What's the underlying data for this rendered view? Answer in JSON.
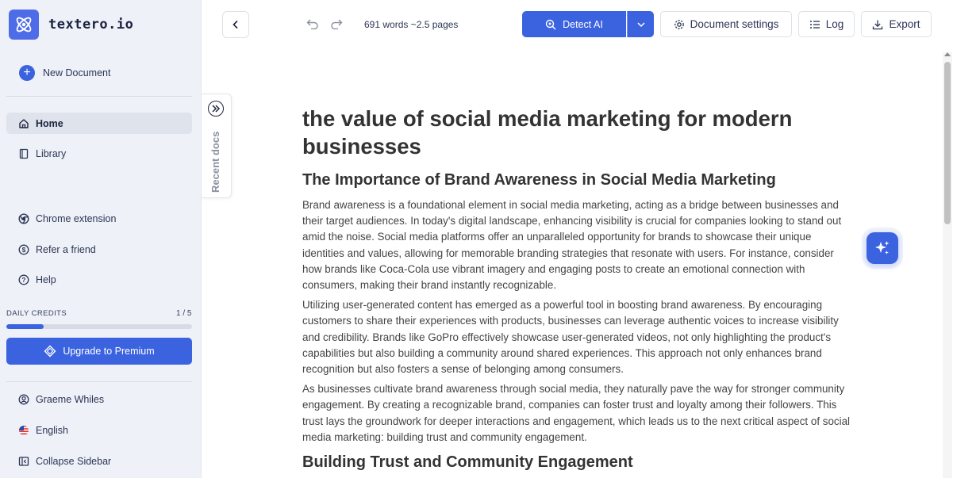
{
  "app": {
    "name": "textero.io"
  },
  "sidebar": {
    "new_document": "New Document",
    "nav": [
      {
        "label": "Home",
        "icon": "home-icon",
        "active": true
      },
      {
        "label": "Library",
        "icon": "book-icon",
        "active": false
      }
    ],
    "secondary": [
      {
        "label": "Chrome extension",
        "icon": "chrome-icon"
      },
      {
        "label": "Refer a friend",
        "icon": "dollar-icon"
      },
      {
        "label": "Help",
        "icon": "help-icon"
      }
    ],
    "credits": {
      "label": "DAILY CREDITS",
      "count": "1 / 5",
      "fraction": 0.2
    },
    "upgrade": "Upgrade to Premium",
    "footer": [
      {
        "label": "Graeme Whiles",
        "icon": "user-icon"
      },
      {
        "label": "English",
        "icon": "us-flag-icon"
      },
      {
        "label": "Collapse Sidebar",
        "icon": "collapse-icon"
      }
    ]
  },
  "toolbar": {
    "word_count": "691 words ~2.5 pages",
    "detect_ai": "Detect AI",
    "document_settings": "Document settings",
    "log": "Log",
    "export": "Export"
  },
  "recent_docs": "Recent docs",
  "document": {
    "title": "the value of social media marketing for modern businesses",
    "sections": [
      {
        "heading": "The Importance of Brand Awareness in Social Media Marketing",
        "paragraphs": [
          "Brand awareness is a foundational element in social media marketing, acting as a bridge between businesses and their target audiences. In today's digital landscape, enhancing visibility is crucial for companies looking to stand out amid the noise. Social media platforms offer an unparalleled opportunity for brands to showcase their unique identities and values, allowing for memorable branding strategies that resonate with users. For instance, consider how brands like Coca-Cola use vibrant imagery and engaging posts to create an emotional connection with consumers, making their brand instantly recognizable.",
          "Utilizing user-generated content has emerged as a powerful tool in boosting brand awareness. By encouraging customers to share their experiences with products, businesses can leverage authentic voices to increase visibility and credibility. Brands like GoPro effectively showcase user-generated videos, not only highlighting the product's capabilities but also building a community around shared experiences. This approach not only enhances brand recognition but also fosters a sense of belonging among consumers.",
          "As businesses cultivate brand awareness through social media, they naturally pave the way for stronger community engagement. By creating a recognizable brand, companies can foster trust and loyalty among their followers. This trust lays the groundwork for deeper interactions and engagement, which leads us to the next critical aspect of social media marketing: building trust and community engagement."
        ]
      },
      {
        "heading": "Building Trust and Community Engagement"
      }
    ]
  },
  "colors": {
    "accent": "#3b63e0",
    "sidebar_bg": "#eef1f7"
  }
}
